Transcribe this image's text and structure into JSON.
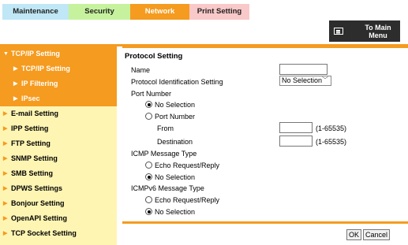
{
  "tabs": [
    {
      "label": "Maintenance"
    },
    {
      "label": "Security"
    },
    {
      "label": "Network"
    },
    {
      "label": "Print Setting"
    }
  ],
  "to_main": {
    "label_line1": "To Main",
    "label_line2": "Menu"
  },
  "sidebar": {
    "items": [
      {
        "label": "TCP/IP Setting"
      },
      {
        "label": "TCP/IP Setting"
      },
      {
        "label": "IP Filtering"
      },
      {
        "label": "IPsec"
      },
      {
        "label": "E-mail Setting"
      },
      {
        "label": "IPP Setting"
      },
      {
        "label": "FTP Setting"
      },
      {
        "label": "SNMP Setting"
      },
      {
        "label": "SMB Setting"
      },
      {
        "label": "DPWS Settings"
      },
      {
        "label": "Bonjour Setting"
      },
      {
        "label": "OpenAPI Setting"
      },
      {
        "label": "TCP Socket Setting"
      }
    ]
  },
  "form": {
    "title": "Protocol Setting",
    "name_label": "Name",
    "name_value": "",
    "protocol_id_label": "Protocol Identification Setting",
    "protocol_id_value": "No Selection",
    "port_number_label": "Port Number",
    "port_no_selection": "No Selection",
    "port_port_number": "Port Number",
    "from_label": "From",
    "from_value": "",
    "from_range": "(1-65535)",
    "destination_label": "Destination",
    "destination_value": "",
    "destination_range": "(1-65535)",
    "icmp_label": "ICMP Message Type",
    "icmp_echo": "Echo Request/Reply",
    "icmp_no_selection": "No Selection",
    "icmpv6_label": "ICMPv6 Message Type",
    "icmpv6_echo": "Echo Request/Reply",
    "icmpv6_no_selection": "No Selection",
    "selected": {
      "port": "No Selection",
      "icmp": "No Selection",
      "icmpv6": "No Selection"
    }
  },
  "buttons": {
    "ok": "OK",
    "cancel": "Cancel"
  },
  "colors": {
    "accent": "#f59b1f",
    "sidebar_bg": "#fff5b3",
    "dark_button": "#2d2d2d"
  }
}
